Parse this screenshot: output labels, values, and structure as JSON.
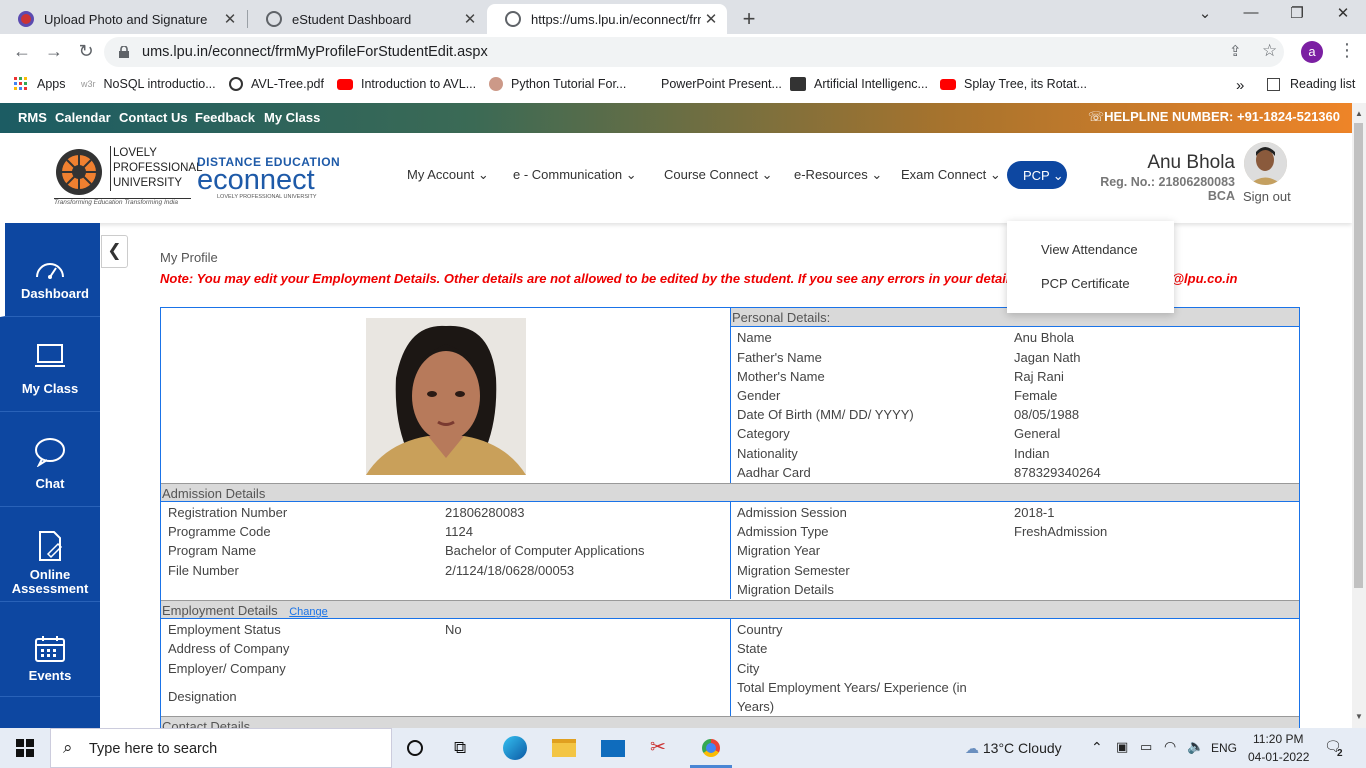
{
  "browser": {
    "tabs": [
      {
        "label": "Upload Photo and Signature",
        "close": "✕"
      },
      {
        "label": "eStudent Dashboard",
        "close": "✕"
      },
      {
        "label": "https://ums.lpu.in/econnect/frmM",
        "close": "✕"
      }
    ],
    "new_tab": "+",
    "url": "ums.lpu.in/econnect/frmMyProfileForStudentEdit.aspx",
    "profile_initial": "a",
    "bookmarks": [
      {
        "label": "Apps"
      },
      {
        "label": "NoSQL introductio..."
      },
      {
        "label": "AVL-Tree.pdf"
      },
      {
        "label": "Introduction to AVL..."
      },
      {
        "label": "Python Tutorial For..."
      },
      {
        "label": "PowerPoint Present..."
      },
      {
        "label": "Artificial Intelligenc..."
      },
      {
        "label": "Splay Tree, its Rotat..."
      }
    ],
    "bookmarks_more": "»",
    "reading_list": "Reading list"
  },
  "topbar": {
    "links": [
      "RMS",
      "Calendar",
      "Contact Us",
      "Feedback",
      "My Class"
    ],
    "helpline": "HELPLINE NUMBER: +91-1824-521360"
  },
  "header": {
    "lpu_logo": {
      "line1": "LOVELY",
      "line2": "PROFESSIONAL",
      "line3": "UNIVERSITY",
      "tagline": "Transforming Education Transforming India"
    },
    "econnect_logo": {
      "top": "DISTANCE EDUCATION",
      "main": "econnect",
      "sub": "LOVELY PROFESSIONAL UNIVERSITY"
    },
    "menu": [
      "My Account",
      "e - Communication",
      "Course Connect",
      "e-Resources",
      "Exam Connect"
    ],
    "active_menu": "PCP",
    "user": {
      "name": "Anu Bhola",
      "reg": "Reg. No.: 21806280083",
      "program": "BCA",
      "signout": "Sign out"
    }
  },
  "dropdown": [
    "View Attendance",
    "PCP Certificate"
  ],
  "sidebar": [
    {
      "label": "Dashboard",
      "icon": "speedometer-icon"
    },
    {
      "label": "My Class",
      "icon": "laptop-icon"
    },
    {
      "label": "Chat",
      "icon": "chat-icon"
    },
    {
      "label": "Online Assessment",
      "icon": "document-edit-icon"
    },
    {
      "label": "Events",
      "icon": "calendar-icon"
    }
  ],
  "main": {
    "page_title": "My Profile",
    "note": "Note: You may edit your Employment Details. Other details are not allowed to be edited by the student. If you see any errors in your details, please write to us at odl@lpu.co.in",
    "personal": {
      "title": "Personal Details:",
      "rows": [
        {
          "label": "Name",
          "value": "Anu Bhola"
        },
        {
          "label": "Father's Name",
          "value": "Jagan Nath"
        },
        {
          "label": "Mother's Name",
          "value": "Raj Rani"
        },
        {
          "label": "Gender",
          "value": "Female"
        },
        {
          "label": "Date Of Birth (MM/ DD/ YYYY)",
          "value": "08/05/1988"
        },
        {
          "label": "Category",
          "value": "General"
        },
        {
          "label": "Nationality",
          "value": "Indian"
        },
        {
          "label": "Aadhar Card",
          "value": "878329340264"
        }
      ]
    },
    "admission": {
      "title": "Admission Details",
      "left": [
        {
          "label": "Registration Number",
          "value": "21806280083"
        },
        {
          "label": "Programme Code",
          "value": "1124"
        },
        {
          "label": "Program Name",
          "value": "Bachelor of Computer Applications"
        },
        {
          "label": "File Number",
          "value": "2/1124/18/0628/00053"
        }
      ],
      "right": [
        {
          "label": "Admission Session",
          "value": "2018-1"
        },
        {
          "label": "Admission Type",
          "value": "FreshAdmission"
        },
        {
          "label": "Migration Year",
          "value": ""
        },
        {
          "label": "Migration Semester",
          "value": ""
        },
        {
          "label": "Migration Details",
          "value": ""
        }
      ]
    },
    "employment": {
      "title": "Employment Details",
      "change": "Change",
      "left": [
        {
          "label": "Employment Status",
          "value": "No"
        },
        {
          "label": "Address of Company",
          "value": ""
        },
        {
          "label": "Employer/ Company",
          "value": ""
        },
        {
          "label": "Designation",
          "value": ""
        }
      ],
      "right": [
        {
          "label": "Country",
          "value": ""
        },
        {
          "label": "State",
          "value": ""
        },
        {
          "label": "City",
          "value": ""
        },
        {
          "label": "Total Employment Years/ Experience (in",
          "label2": " Years)",
          "value": ""
        }
      ]
    },
    "contact": {
      "title": "Contact Details"
    }
  },
  "taskbar": {
    "search_placeholder": "Type here to search",
    "weather": "13°C  Cloudy",
    "lang": "ENG",
    "time": "11:20 PM",
    "date": "04-01-2022",
    "notifications": "2"
  },
  "colors": {
    "brand_blue": "#0d47a1",
    "note_red": "#ee0000",
    "table_border": "#1a73e8",
    "section_grey": "#d9d9d9"
  }
}
